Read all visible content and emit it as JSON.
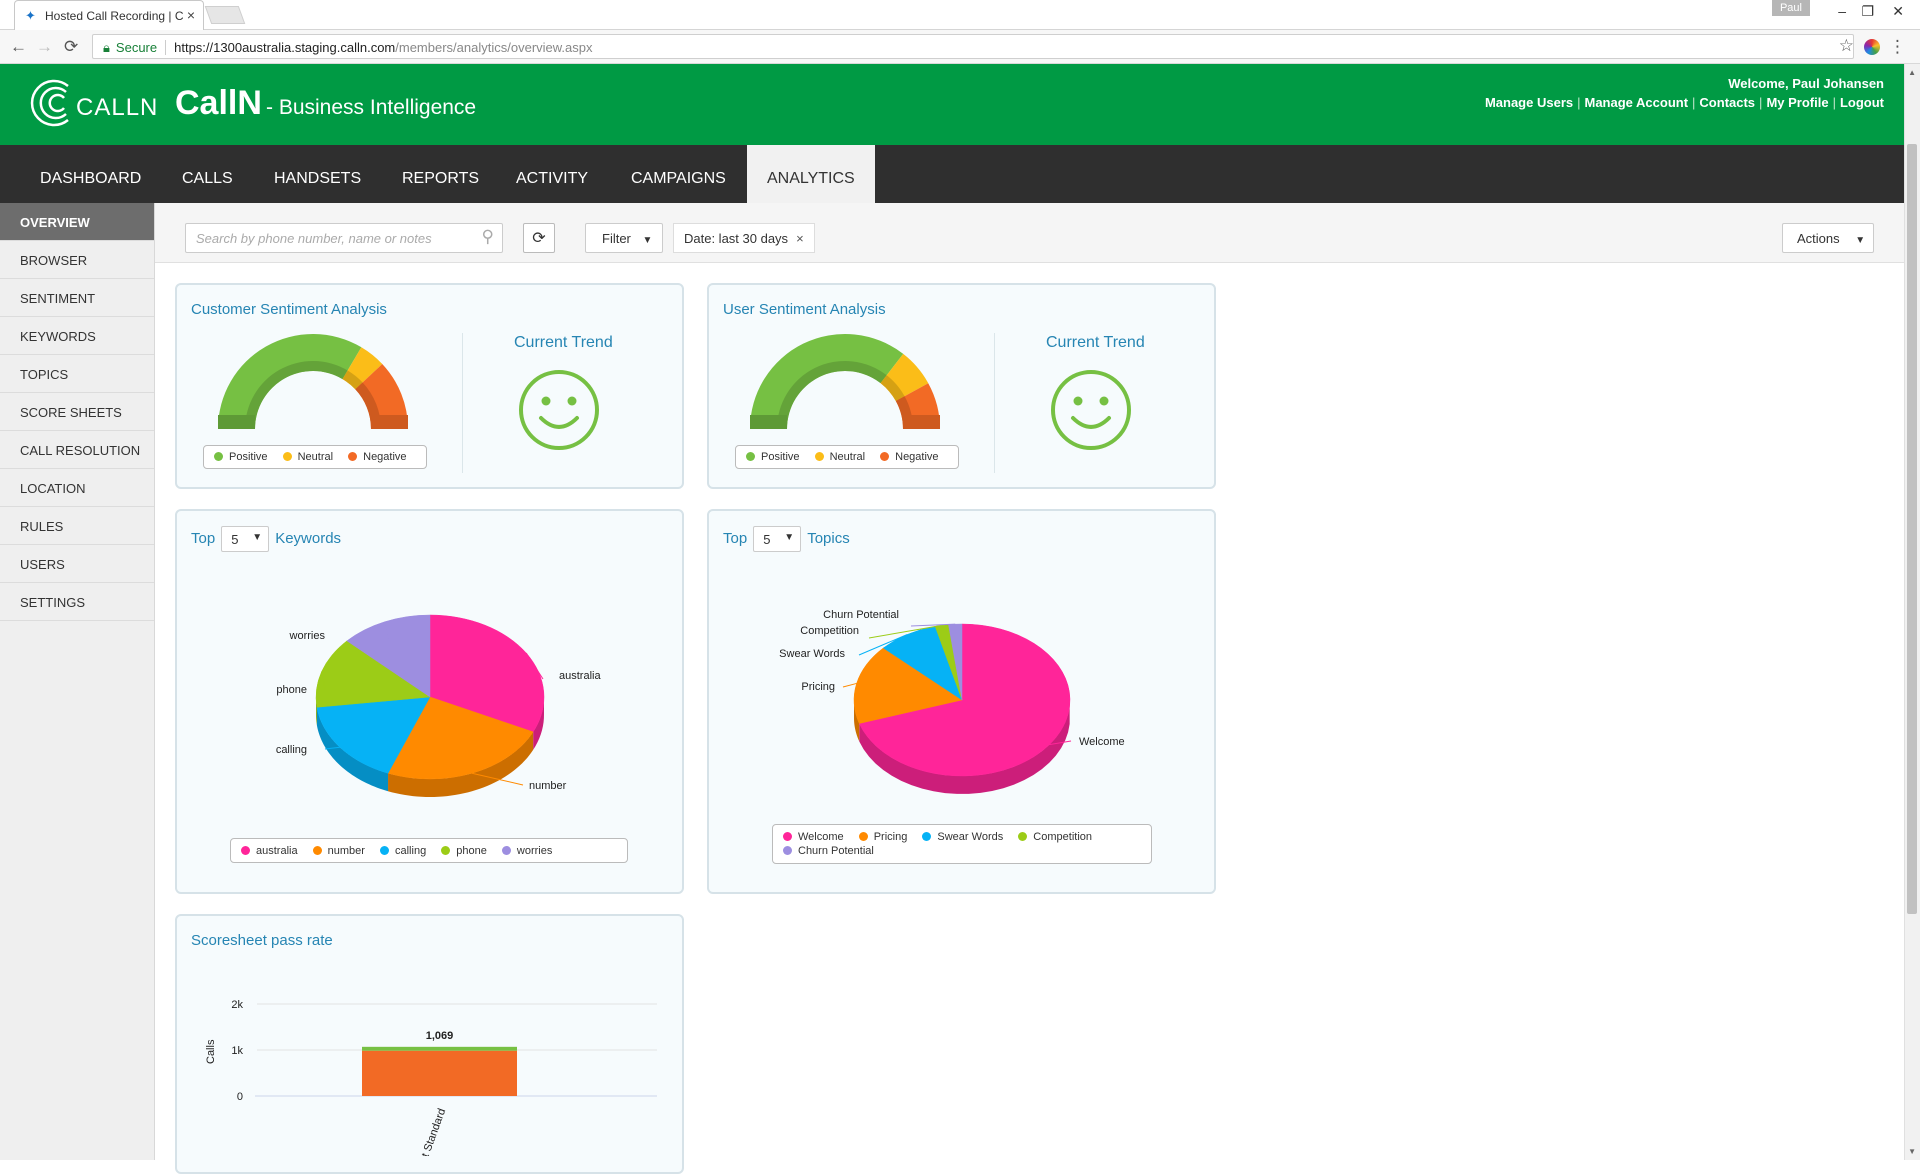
{
  "browser": {
    "tab_title": "Hosted Call Recording | C",
    "profile": "Paul",
    "secure_label": "Secure",
    "url_host": "https://1300australia.staging.calln.com",
    "url_path": "/members/analytics/overview.aspx"
  },
  "header": {
    "logo_text": "CALLN",
    "title": "CallN",
    "subtitle": "- Business Intelligence",
    "welcome": "Welcome, Paul Johansen",
    "links": [
      "Manage Users",
      "Manage Account",
      "Contacts",
      "My Profile",
      "Logout"
    ],
    "brand_color": "#009a44"
  },
  "nav": {
    "items": [
      "DASHBOARD",
      "CALLS",
      "HANDSETS",
      "REPORTS",
      "ACTIVITY",
      "CAMPAIGNS",
      "ANALYTICS"
    ],
    "active": "ANALYTICS"
  },
  "sidebar": {
    "items": [
      "OVERVIEW",
      "BROWSER",
      "SENTIMENT",
      "KEYWORDS",
      "TOPICS",
      "SCORE SHEETS",
      "CALL RESOLUTION",
      "LOCATION",
      "RULES",
      "USERS",
      "SETTINGS"
    ],
    "active": "OVERVIEW"
  },
  "toolbar": {
    "search_placeholder": "Search by phone number, name or notes",
    "filter_label": "Filter",
    "date_chip": "Date: last 30 days",
    "actions_label": "Actions"
  },
  "customer_sentiment": {
    "title": "Customer Sentiment Analysis",
    "trend_title": "Current Trend",
    "trend_icon": "smiley-icon",
    "legend": [
      "Positive",
      "Neutral",
      "Negative"
    ]
  },
  "user_sentiment": {
    "title": "User Sentiment Analysis",
    "trend_title": "Current Trend",
    "trend_icon": "smiley-icon",
    "legend": [
      "Positive",
      "Neutral",
      "Negative"
    ]
  },
  "keywords": {
    "top_label": "Top",
    "top_value": "5",
    "suffix": "Keywords"
  },
  "topics": {
    "top_label": "Top",
    "top_value": "5",
    "suffix": "Topics"
  },
  "scoresheet": {
    "title": "Scoresheet pass rate"
  },
  "colors": {
    "positive": "#76c043",
    "neutral": "#fbbd18",
    "negative": "#f26a25",
    "pink": "#ff2599",
    "orange": "#ff8a00",
    "blue": "#06b2f5",
    "lime": "#9ccc17",
    "purple": "#9d8ee0"
  },
  "chart_data": [
    {
      "type": "pie",
      "variant": "semi-donut",
      "categories": [
        "Positive",
        "Neutral",
        "Negative"
      ],
      "values": [
        67,
        9,
        24
      ]
    },
    {
      "type": "pie",
      "variant": "semi-donut",
      "categories": [
        "Positive",
        "Neutral",
        "Negative"
      ],
      "values": [
        71,
        13,
        16
      ]
    },
    {
      "type": "pie",
      "variant": "3d",
      "categories": [
        "australia",
        "number",
        "calling",
        "phone",
        "worries"
      ],
      "values": [
        32,
        24,
        17,
        14,
        13
      ],
      "legend": "bottom"
    },
    {
      "type": "pie",
      "variant": "3d",
      "categories": [
        "Welcome",
        "Pricing",
        "Swear Words",
        "Competition",
        "Churn Potential"
      ],
      "values": [
        70,
        17,
        9,
        2,
        2
      ],
      "legend": "bottom"
    },
    {
      "type": "bar",
      "categories": [
        "Support Standard"
      ],
      "series": [
        {
          "values": [
            985
          ],
          "color": "#f26a25"
        },
        {
          "values": [
            84
          ],
          "color": "#76c043"
        }
      ],
      "total_labels": [
        "1,069"
      ],
      "ylabel": "Calls",
      "yticks": [
        "0",
        "1k",
        "2k"
      ],
      "ylim": [
        0,
        2000
      ]
    }
  ]
}
